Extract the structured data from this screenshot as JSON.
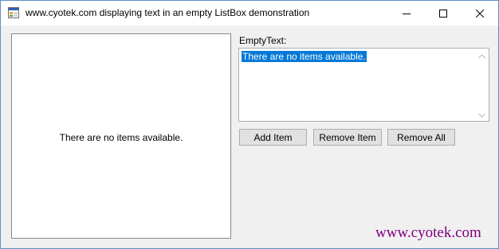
{
  "window": {
    "title": "www.cyotek.com displaying text in an empty ListBox demonstration",
    "icon": "app-form-icon",
    "caption_buttons": [
      "minimize-icon",
      "maximize-icon",
      "close-icon"
    ]
  },
  "listbox": {
    "empty_text": "There are no items available."
  },
  "empty_text_editor": {
    "label": "EmptyText:",
    "value": "There are no items available."
  },
  "buttons": {
    "add": "Add Item",
    "remove": "Remove Item",
    "remove_all": "Remove All"
  },
  "watermark": "www.cyotek.com",
  "colors": {
    "selection": "#0078d7",
    "watermark": "#800080",
    "window_border": "#5f8fc6"
  }
}
